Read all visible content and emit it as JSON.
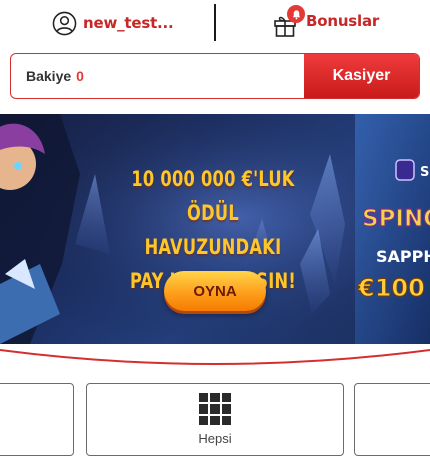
{
  "header": {
    "username": "new_test...",
    "user_icon": "user-circle-icon",
    "bonus_label": "Bonuslar",
    "bonus_icon": "gift-icon",
    "bonus_badge_icon": "bell-icon"
  },
  "balance": {
    "label": "Bakiye",
    "amount": "0",
    "cashier_label": "Kasiyer"
  },
  "banner": {
    "line1": "10 000 000 €'LUK",
    "line2": "ÖDÜL HAVUZUNDAKI",
    "line3": "PAY IÇIN YARIŞIN!",
    "play_label": "OYNA",
    "partial_logo_text": "S",
    "partial_title": "SPINO",
    "partial_subtitle": "SAPPH",
    "partial_amount": "€100"
  },
  "categories": {
    "active_label": "Hepsi",
    "active_icon": "grid-icon"
  },
  "colors": {
    "accent_red": "#d32f2f",
    "banner_gold": "#ffc629",
    "play_orange": "#ff9e1b"
  }
}
